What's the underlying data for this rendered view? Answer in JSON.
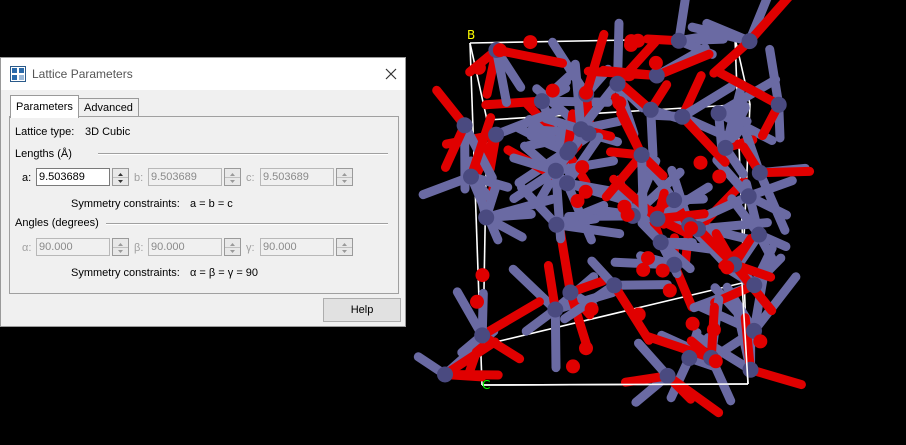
{
  "viewport": {
    "axis_labels": {
      "b": "B",
      "c": "C"
    },
    "colors": {
      "atom_metal": "#6a6aa3",
      "atom_oxygen": "#e00000",
      "cell_edge": "#ffffff",
      "label_b": "#ffff00",
      "label_c": "#00ff00",
      "background": "#000000"
    }
  },
  "dialog": {
    "title": "Lattice Parameters",
    "icons": {
      "window": "lattice-window-icon",
      "close": "close-icon"
    },
    "tabs": [
      {
        "label": "Parameters",
        "active": true
      },
      {
        "label": "Advanced",
        "active": false
      }
    ],
    "lattice_type_label": "Lattice type:",
    "lattice_type_value": "3D Cubic",
    "lengths": {
      "heading": "Lengths (Å)",
      "a_label": "a:",
      "a_value": "9.503689",
      "b_label": "b:",
      "b_value": "9.503689",
      "c_label": "c:",
      "c_value": "9.503689",
      "constraints_label": "Symmetry constraints:",
      "constraints_value": "a = b = c"
    },
    "angles": {
      "heading": "Angles (degrees)",
      "alpha_label": "α:",
      "alpha_value": "90.000",
      "beta_label": "β:",
      "beta_value": "90.000",
      "gamma_label": "γ:",
      "gamma_value": "90.000",
      "constraints_label": "Symmetry constraints:",
      "constraints_value": "α = β = γ = 90"
    },
    "help_button": "Help"
  }
}
